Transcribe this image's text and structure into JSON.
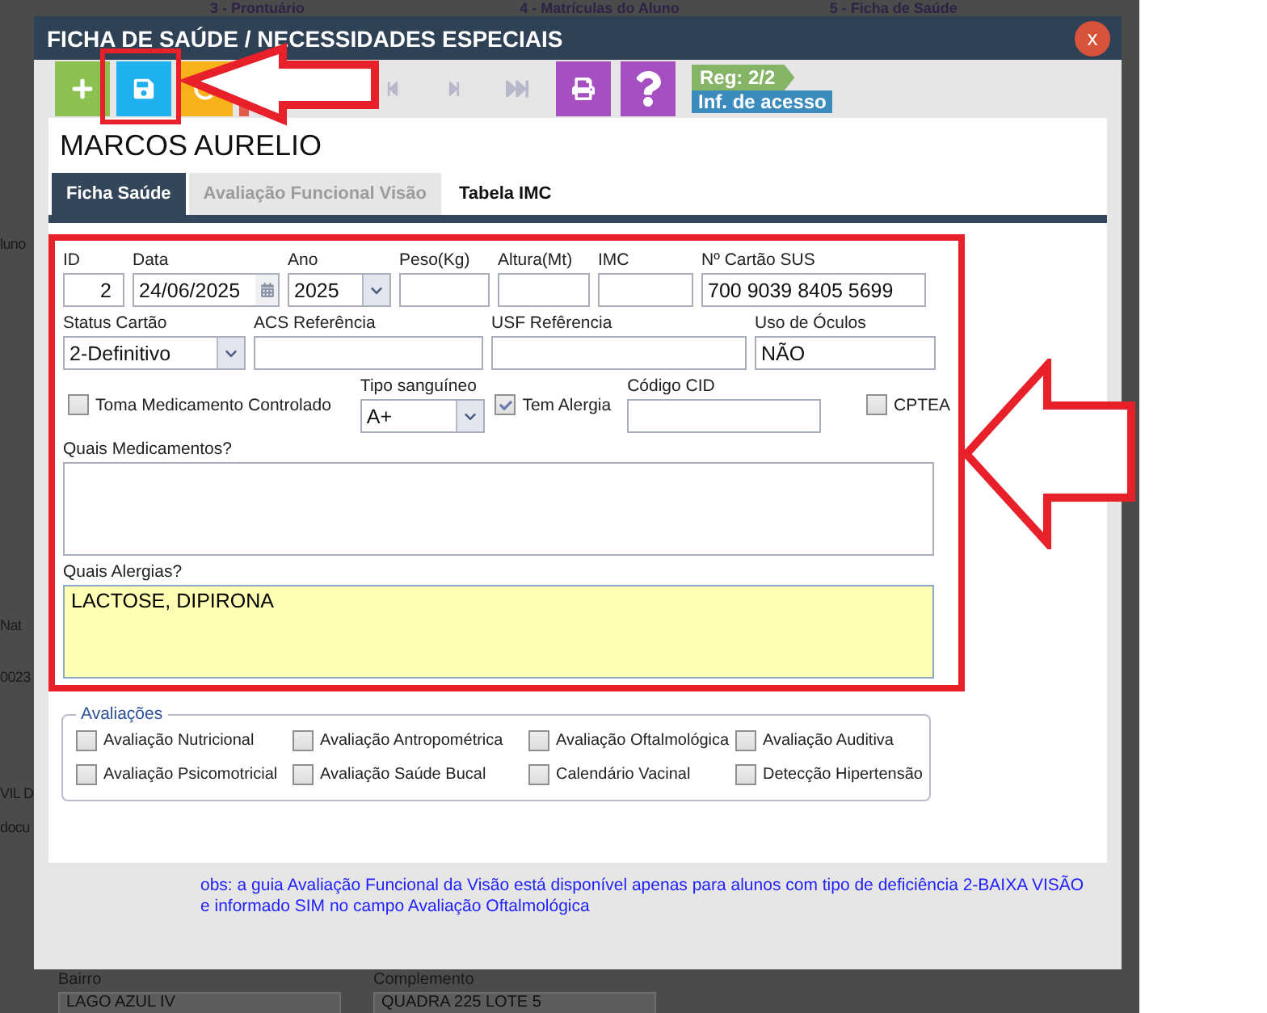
{
  "background_page": {
    "tabs": [
      "3 - Prontuário",
      "4 - Matrículas do Aluno",
      "5 - Ficha de Saúde"
    ],
    "side_fragments": [
      "luno",
      "Nat",
      "0023",
      "VIL D",
      "docu"
    ],
    "fields": [
      {
        "label": "Bairro",
        "value": "LAGO AZUL IV"
      },
      {
        "label": "Complemento",
        "value": "QUADRA 225 LOTE 5"
      }
    ]
  },
  "dialog": {
    "title": "FICHA DE SAÚDE / NECESSIDADES ESPECIAIS",
    "close": "x"
  },
  "toolbar": {
    "buttons": [
      {
        "kind": "add"
      },
      {
        "kind": "save"
      },
      {
        "kind": "undo"
      },
      {
        "kind": "delete"
      },
      {
        "kind": "previous",
        "disabled": true
      },
      {
        "kind": "next",
        "disabled": true
      },
      {
        "kind": "last",
        "disabled": true
      },
      {
        "kind": "print"
      },
      {
        "kind": "help"
      }
    ],
    "record": "Reg: 2/2",
    "access": "Inf. de acesso"
  },
  "student_name": "MARCOS AURELIO",
  "tabs": [
    {
      "label": "Ficha Saúde",
      "selected": true,
      "disabled": false
    },
    {
      "label": "Avaliação Funcional Visão",
      "selected": false,
      "disabled": true
    },
    {
      "label": "Tabela IMC",
      "selected": false,
      "disabled": false
    }
  ],
  "form": {
    "row1": [
      {
        "kind": "number",
        "label": "ID",
        "value": "2"
      },
      {
        "kind": "date",
        "label": "Data",
        "value": "24/06/2025"
      },
      {
        "kind": "select",
        "label": "Ano",
        "value": "2025"
      },
      {
        "kind": "text",
        "label": "Peso(Kg)"
      },
      {
        "kind": "text",
        "label": "Altura(Mt)"
      },
      {
        "kind": "text",
        "label": "IMC"
      },
      {
        "kind": "text",
        "label": "Nº Cartão SUS",
        "value": "700 9039 8405 5699"
      }
    ],
    "row2": [
      {
        "kind": "select",
        "label": "Status Cartão",
        "value": "2-Definitivo"
      },
      {
        "kind": "text",
        "label": "ACS Referência"
      },
      {
        "kind": "text",
        "label": "USF Refêrencia"
      },
      {
        "kind": "text",
        "label": "Uso de Óculos",
        "value": "NÃO"
      }
    ],
    "row3": [
      {
        "kind": "checkbox",
        "label": "Toma Medicamento Controlado",
        "checked": false
      },
      {
        "kind": "select",
        "label": "Tipo sanguíneo",
        "value": "A+"
      },
      {
        "kind": "checkbox",
        "label": "Tem Alergia",
        "checked": true
      },
      {
        "kind": "text",
        "label": "Código CID"
      },
      {
        "kind": "checkbox",
        "label": "CPTEA",
        "checked": false
      }
    ],
    "medications": {
      "label": "Quais Medicamentos?"
    },
    "allergies": {
      "label": "Quais Alergias?",
      "value": "LACTOSE, DIPIRONA"
    }
  },
  "evaluations": {
    "legend": "Avaliações",
    "items": [
      {
        "label": "Avaliação Nutricional",
        "checked": false
      },
      {
        "label": "Avaliação Antropométrica",
        "checked": false
      },
      {
        "label": "Avaliação Oftalmológica",
        "checked": false
      },
      {
        "label": "Avaliação Auditiva",
        "checked": false
      },
      {
        "label": "Avaliação Psicomotricial",
        "checked": false
      },
      {
        "label": "Avaliação Saúde Bucal",
        "checked": false
      },
      {
        "label": "Calendário Vacinal",
        "checked": false
      },
      {
        "label": "Detecção Hipertensão",
        "checked": false
      }
    ]
  },
  "note": [
    "obs: a guia Avaliação Funcional da Visão está disponível apenas para alunos com tipo de deficiência 2-BAIXA VISÃO",
    "e informado SIM no campo Avaliação Oftalmológica"
  ]
}
